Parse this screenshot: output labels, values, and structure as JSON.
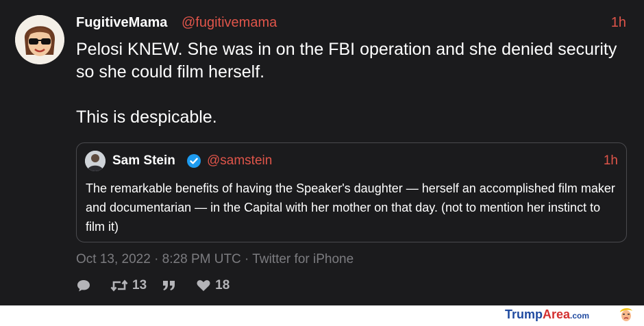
{
  "tweet": {
    "display_name": "FugitiveMama",
    "handle": "@fugitivemama",
    "time": "1h",
    "text": "Pelosi KNEW. She was in on the FBI operation and she denied security so she could film herself.\n\nThis is despicable.",
    "avatar_icon": "bitmoji-woman-sunglasses"
  },
  "quote": {
    "display_name": "Sam Stein",
    "verified_icon": "verified-badge-icon",
    "handle": "@samstein",
    "time": "1h",
    "text": "The remarkable benefits of having the Speaker's daughter — herself an accomplished film maker and documentarian — in the Capital with her mother on that day. (not to mention her instinct to film it)"
  },
  "meta": {
    "line": "Oct 13, 2022 · 8:28 PM UTC · Twitter for iPhone"
  },
  "actions": {
    "reply_count": "",
    "retweet_count": "13",
    "quote_count": "",
    "like_count": "18"
  },
  "footer": {
    "brand_trump": "Trump",
    "brand_area": "Area",
    "brand_com": ".com"
  },
  "colors": {
    "card_bg": "#1b1b1d",
    "accent": "#e0554a",
    "muted": "#7c7c80",
    "verified": "#1d9bf0"
  }
}
